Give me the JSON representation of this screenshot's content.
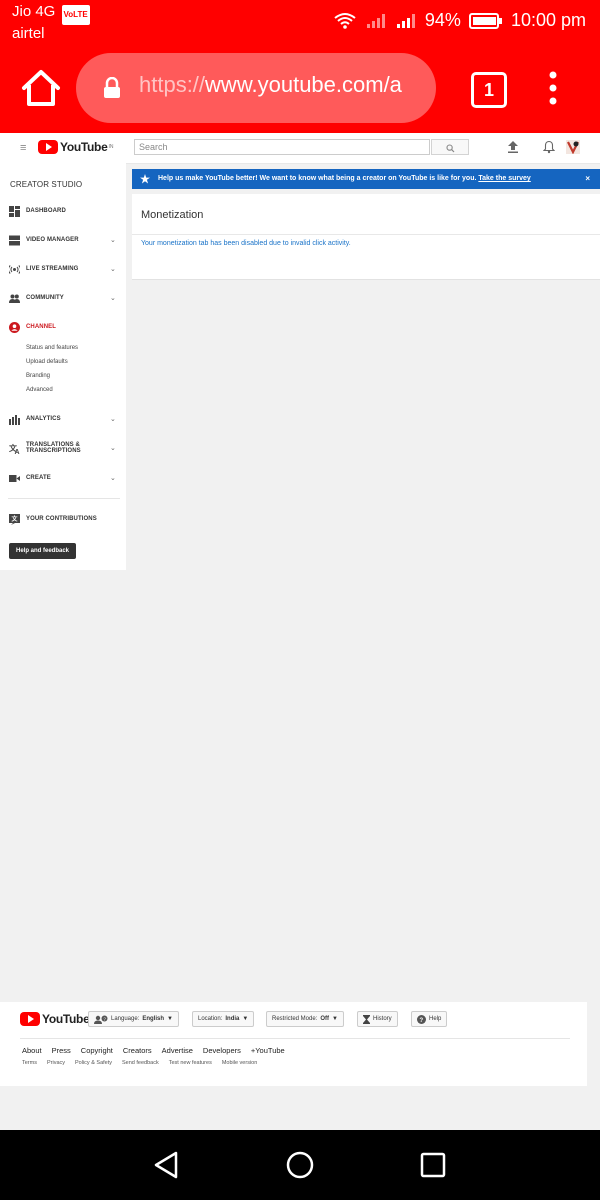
{
  "status_bar": {
    "carrier1": "Jio 4G",
    "volte": "VoLTE",
    "carrier2": "airtel",
    "battery": "94%",
    "time": "10:00 pm"
  },
  "browser": {
    "url_dim": "https://",
    "url_main": "www.youtube.com/a",
    "tab_count": "1"
  },
  "yt_header": {
    "logo_text": "YouTube",
    "country": "IN",
    "search_placeholder": "Search"
  },
  "sidebar": {
    "title": "CREATOR STUDIO",
    "items": [
      {
        "label": "DASHBOARD"
      },
      {
        "label": "VIDEO MANAGER"
      },
      {
        "label": "LIVE STREAMING"
      },
      {
        "label": "COMMUNITY"
      },
      {
        "label": "CHANNEL"
      },
      {
        "label": "ANALYTICS"
      },
      {
        "label": "TRANSLATIONS &"
      },
      {
        "label": "TRANSCRIPTIONS"
      },
      {
        "label": "CREATE"
      },
      {
        "label": "YOUR CONTRIBUTIONS"
      }
    ],
    "channel_sub": [
      "Status and features",
      "Upload defaults",
      "Branding",
      "Advanced"
    ],
    "help_button": "Help and feedback"
  },
  "survey": {
    "message": "Help us make YouTube better! We want to know what being a creator on YouTube is like for you.",
    "link": "Take the survey",
    "close": "×"
  },
  "main": {
    "title": "Monetization",
    "message": "Your monetization tab has been disabled due to invalid click activity."
  },
  "footer": {
    "logo_text": "YouTube",
    "language_label": "Language:",
    "language_value": "English",
    "location_label": "Location:",
    "location_value": "India",
    "restricted_label": "Restricted Mode:",
    "restricted_value": "Off",
    "history": "History",
    "help": "Help",
    "links": [
      "About",
      "Press",
      "Copyright",
      "Creators",
      "Advertise",
      "Developers",
      "+YouTube"
    ],
    "sub_links": [
      "Terms",
      "Privacy",
      "Policy & Safety",
      "Send feedback",
      "Test new features",
      "Mobile version"
    ]
  },
  "colors": {
    "brand_red": "#ff0000",
    "survey_blue": "#1565c0",
    "link_blue": "#1a73c8"
  }
}
